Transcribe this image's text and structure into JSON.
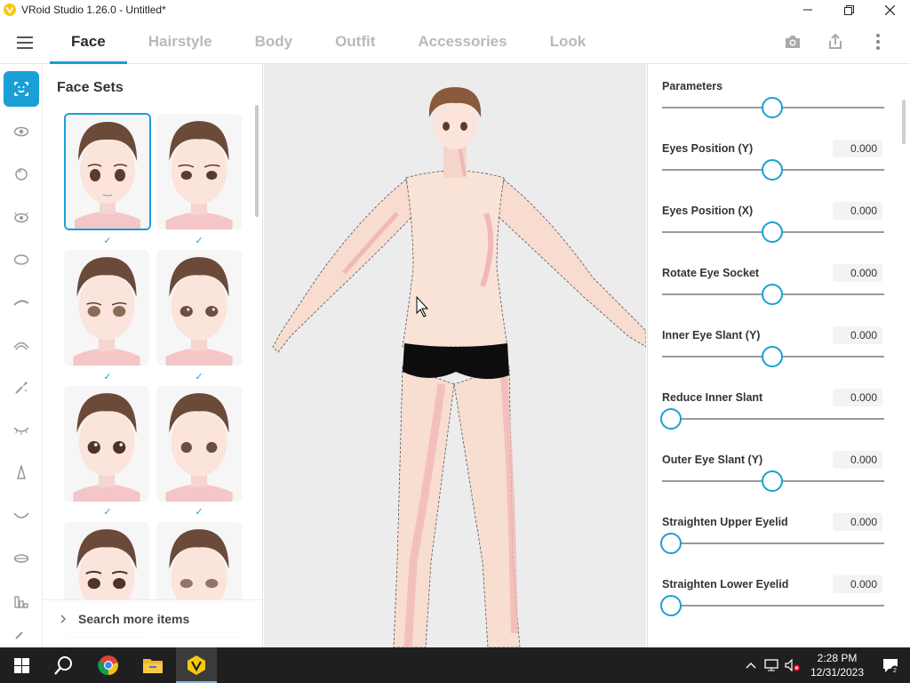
{
  "window": {
    "title": "VRoid Studio 1.26.0 - Untitled*"
  },
  "tabs": [
    {
      "label": "Face",
      "active": true
    },
    {
      "label": "Hairstyle",
      "active": false
    },
    {
      "label": "Body",
      "active": false
    },
    {
      "label": "Outfit",
      "active": false
    },
    {
      "label": "Accessories",
      "active": false
    },
    {
      "label": "Look",
      "active": false
    }
  ],
  "facesets": {
    "title": "Face Sets",
    "search_more": "Search more items"
  },
  "parameters": [
    {
      "label": "Parameters",
      "value": "",
      "level": 0.5
    },
    {
      "label": "Eyes Position (Y)",
      "value": "0.000",
      "level": 0.5
    },
    {
      "label": "Eyes Position (X)",
      "value": "0.000",
      "level": 0.5
    },
    {
      "label": "Rotate Eye Socket",
      "value": "0.000",
      "level": 0.5
    },
    {
      "label": "Inner Eye Slant (Y)",
      "value": "0.000",
      "level": 0.5
    },
    {
      "label": "Reduce Inner Slant",
      "value": "0.000",
      "level": 0.0
    },
    {
      "label": "Outer Eye Slant (Y)",
      "value": "0.000",
      "level": 0.5
    },
    {
      "label": "Straighten Upper Eyelid",
      "value": "0.000",
      "level": 0.0
    },
    {
      "label": "Straighten Lower Eyelid",
      "value": "0.000",
      "level": 0.0
    }
  ],
  "taskbar": {
    "time": "2:28 PM",
    "date": "12/31/2023"
  },
  "colors": {
    "accent": "#1a9fd6",
    "taskbar": "#1f1f1f"
  }
}
